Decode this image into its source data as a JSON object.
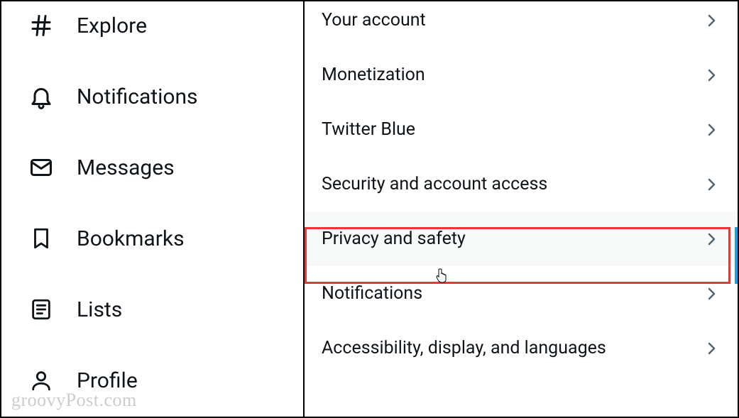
{
  "sidebar": {
    "items": [
      {
        "label": "Explore",
        "icon": "hash-icon"
      },
      {
        "label": "Notifications",
        "icon": "bell-icon"
      },
      {
        "label": "Messages",
        "icon": "envelope-icon"
      },
      {
        "label": "Bookmarks",
        "icon": "bookmark-icon"
      },
      {
        "label": "Lists",
        "icon": "list-icon"
      },
      {
        "label": "Profile",
        "icon": "person-icon"
      }
    ]
  },
  "settings": {
    "items": [
      {
        "label": "Your account"
      },
      {
        "label": "Monetization"
      },
      {
        "label": "Twitter Blue"
      },
      {
        "label": "Security and account access"
      },
      {
        "label": "Privacy and safety",
        "selected": true
      },
      {
        "label": "Notifications"
      },
      {
        "label": "Accessibility, display, and languages"
      }
    ]
  },
  "watermark": "groovyPost.com"
}
